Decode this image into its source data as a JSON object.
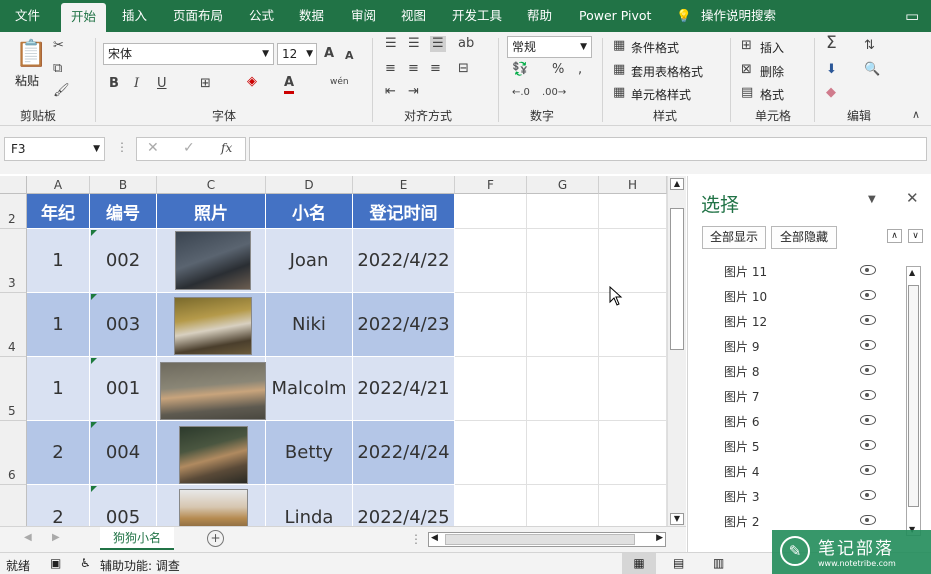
{
  "menu": {
    "items": [
      "文件",
      "开始",
      "插入",
      "页面布局",
      "公式",
      "数据",
      "审阅",
      "视图",
      "开发工具",
      "帮助",
      "Power Pivot",
      "操作说明搜索"
    ],
    "active": "开始"
  },
  "ribbon": {
    "clipboard": {
      "paste": "粘贴",
      "group": "剪贴板"
    },
    "font": {
      "name": "宋体",
      "size": "12",
      "group": "字体",
      "bold": "B",
      "italic": "I",
      "underline": "U",
      "grow": "A",
      "shrink": "A",
      "phonetic": "wén"
    },
    "align": {
      "group": "对齐方式"
    },
    "number": {
      "format": "常规",
      "group": "数字",
      "percent": "%"
    },
    "styles": {
      "cond": "条件格式",
      "table": "套用表格格式",
      "cell": "单元格样式",
      "group": "样式"
    },
    "cells": {
      "insert": "插入",
      "delete": "删除",
      "format": "格式",
      "group": "单元格"
    },
    "editing": {
      "group": "编辑"
    }
  },
  "formula_bar": {
    "name_box": "F3",
    "fx": "fx",
    "value": ""
  },
  "grid": {
    "columns": [
      "A",
      "B",
      "C",
      "D",
      "E",
      "F",
      "G",
      "H"
    ],
    "rows": [
      "2",
      "3",
      "4",
      "5",
      "6"
    ],
    "headers": [
      "年纪",
      "编号",
      "照片",
      "小名",
      "登记时间"
    ],
    "data": [
      {
        "grade": "1",
        "id": "002",
        "name": "Joan",
        "date": "2022/4/22"
      },
      {
        "grade": "1",
        "id": "003",
        "name": "Niki",
        "date": "2022/4/23"
      },
      {
        "grade": "1",
        "id": "001",
        "name": "Malcolm",
        "date": "2022/4/21"
      },
      {
        "grade": "2",
        "id": "004",
        "name": "Betty",
        "date": "2022/4/24"
      },
      {
        "grade": "2",
        "id": "005",
        "name": "Linda",
        "date": "2022/4/25"
      }
    ]
  },
  "sheet": {
    "tab": "狗狗小名"
  },
  "status": {
    "ready": "就绪",
    "accessibility": "辅助功能: 调查"
  },
  "pane": {
    "title": "选择",
    "show_all": "全部显示",
    "hide_all": "全部隐藏",
    "items": [
      "图片 11",
      "图片 10",
      "图片 12",
      "图片 9",
      "图片 8",
      "图片 7",
      "图片 6",
      "图片 5",
      "图片 4",
      "图片 3",
      "图片 2"
    ]
  },
  "watermark": {
    "text": "笔记部落",
    "url": "www.notetribe.com"
  },
  "colors": {
    "excel_green": "#217346",
    "header_blue": "#4472c4",
    "row_dark": "#b4c6e7",
    "row_light": "#d9e1f2"
  }
}
